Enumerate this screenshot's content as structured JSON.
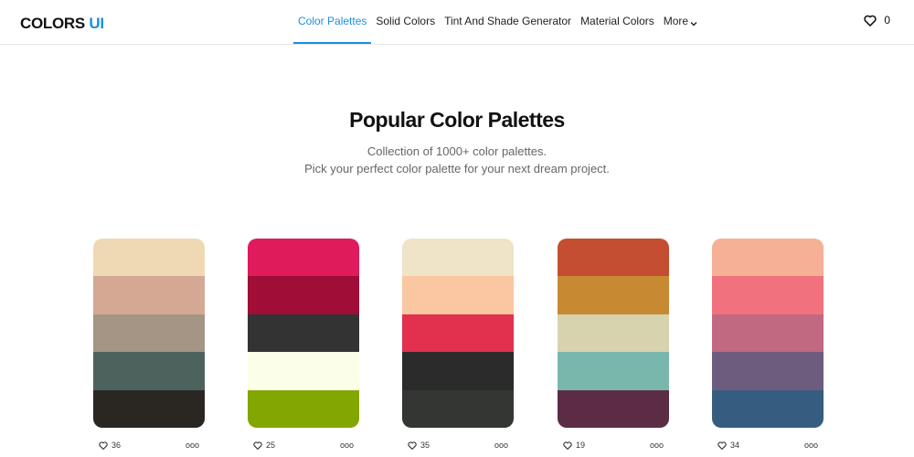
{
  "header": {
    "logo_main": "COLORS",
    "logo_accent": "UI",
    "accent_color": "#1a8fe3",
    "nav": [
      {
        "label": "Color Palettes",
        "active": true
      },
      {
        "label": "Solid Colors"
      },
      {
        "label": "Tint And Shade Generator"
      },
      {
        "label": "Material Colors"
      },
      {
        "label": "More"
      }
    ],
    "favorites_count": "0"
  },
  "hero": {
    "title": "Popular Color Palettes",
    "line1": "Collection of 1000+ color palettes.",
    "line2": "Pick your perfect color palette for your next dream project."
  },
  "palettes": [
    {
      "colors": [
        "#efd9b4",
        "#d5a894",
        "#a59584",
        "#4d625d",
        "#2a2622"
      ],
      "likes": "36"
    },
    {
      "colors": [
        "#df1b5b",
        "#a00d36",
        "#333333",
        "#fbfee8",
        "#82a602"
      ],
      "likes": "25"
    },
    {
      "colors": [
        "#efe3c8",
        "#fbc7a2",
        "#e2304f",
        "#2b2b2b",
        "#333633"
      ],
      "likes": "35"
    },
    {
      "colors": [
        "#c44e31",
        "#c88933",
        "#d7d3ae",
        "#79b7ac",
        "#5c2c45"
      ],
      "likes": "19"
    },
    {
      "colors": [
        "#f6b096",
        "#f2717e",
        "#c06980",
        "#6d5c7e",
        "#355d80"
      ],
      "likes": "34"
    }
  ],
  "more_glyph": "ooo"
}
